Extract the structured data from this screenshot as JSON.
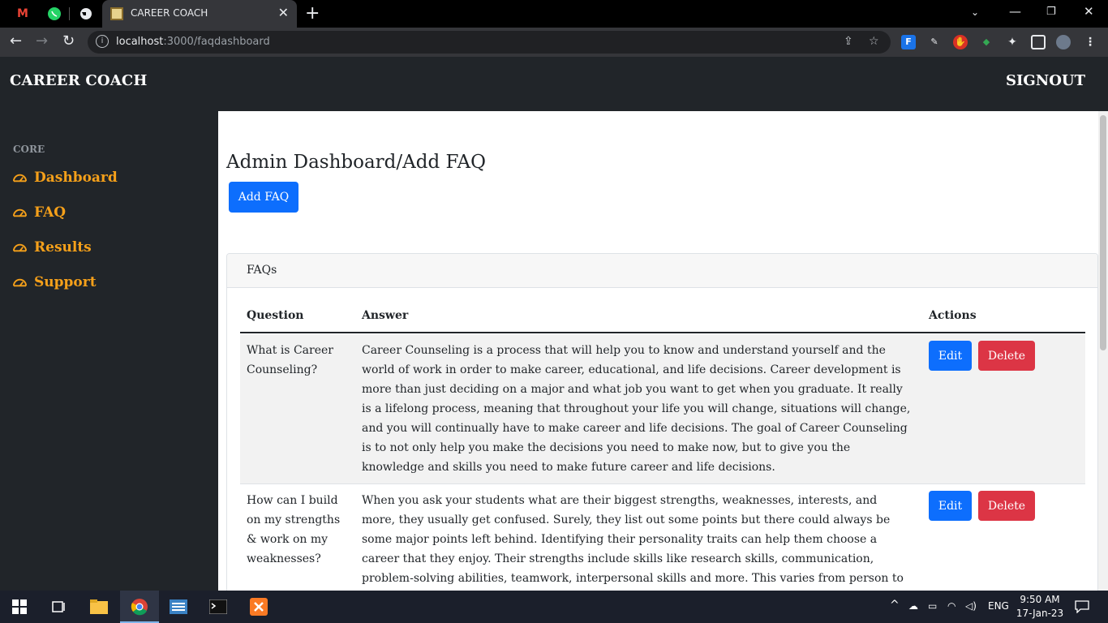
{
  "browser": {
    "tab_title": "CAREER COACH",
    "url_host": "localhost",
    "url_path": ":3000/faqdashboard",
    "new_tab": "+",
    "close": "✕"
  },
  "header": {
    "brand": "CAREER COACH",
    "signout": "SIGNOUT"
  },
  "sidebar": {
    "heading": "CORE",
    "items": [
      {
        "label": "Dashboard"
      },
      {
        "label": "FAQ"
      },
      {
        "label": "Results"
      },
      {
        "label": "Support"
      }
    ],
    "accent_color": "#f5a01a"
  },
  "main": {
    "title": "Admin Dashboard/Add FAQ",
    "add_button": "Add FAQ",
    "card_title": "FAQs",
    "columns": [
      "Question",
      "Answer",
      "Actions"
    ],
    "rows": [
      {
        "question": "What is Career Counseling?",
        "answer": "Career Counseling is a process that will help you to know and understand yourself and the world of work in order to make career, educational, and life decisions. Career development is more than just deciding on a major and what job you want to get when you graduate. It really is a lifelong process, meaning that throughout your life you will change, situations will change, and you will continually have to make career and life decisions. The goal of Career Counseling is to not only help you make the decisions you need to make now, but to give you the knowledge and skills you need to make future career and life decisions.",
        "edit": "Edit",
        "delete": "Delete"
      },
      {
        "question": "How can I build on my strengths & work on my weaknesses?",
        "answer": "When you ask your students what are their biggest strengths, weaknesses, interests, and more, they usually get confused. Surely, they list out some points but there could always be some major points left behind. Identifying their personality traits can help them choose a career that they enjoy. Their strengths include skills like research skills, communication, problem-solving abilities, teamwork, interpersonal skills and more. This varies from person to person and the profession",
        "edit": "Edit",
        "delete": "Delete"
      }
    ],
    "primary_color": "#0d6efd",
    "danger_color": "#dc3545"
  },
  "taskbar": {
    "lang": "ENG",
    "time": "9:50 AM",
    "date": "17-Jan-23"
  }
}
